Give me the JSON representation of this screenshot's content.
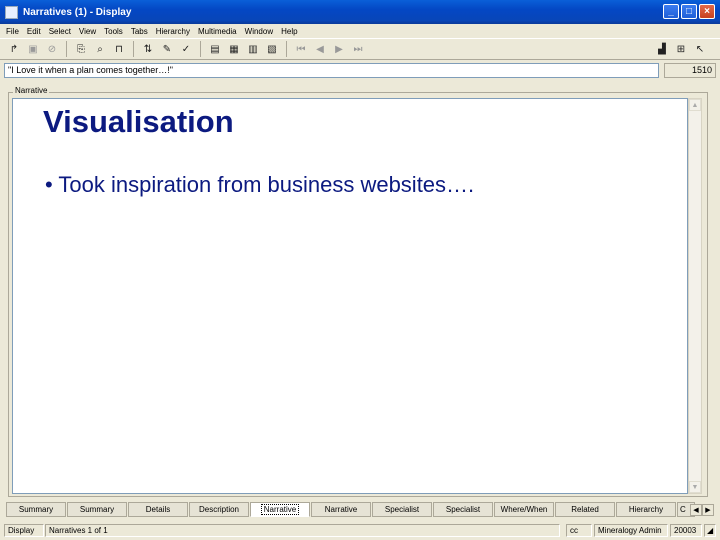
{
  "window": {
    "title": "Narratives (1) - Display",
    "controls": [
      "_",
      "□",
      "×"
    ]
  },
  "menu": [
    "File",
    "Edit",
    "Select",
    "View",
    "Tools",
    "Tabs",
    "Hierarchy",
    "Multimedia",
    "Window",
    "Help"
  ],
  "toolbar": {
    "left": [
      "new-icon",
      "save-icon",
      "cancel-icon",
      "copy-icon",
      "find-icon",
      "filter-icon",
      "sort-icon",
      "edit-icon",
      "spell-icon",
      "report-icon",
      "table-icon",
      "form-icon",
      "view-icon",
      "first-icon",
      "prev-icon",
      "next-icon",
      "last-icon"
    ],
    "right": [
      "chart-icon",
      "tag-icon",
      "help-pointer-icon"
    ]
  },
  "record": {
    "title": "\"I Love it when a plan comes together…!\"",
    "number": "1510"
  },
  "group_label": "Narrative",
  "content": {
    "heading": "Visualisation",
    "bullet": "•  Took inspiration from business websites…."
  },
  "tabs": [
    "Summary",
    "Summary",
    "Details",
    "Description",
    "Narrative",
    "Narrative",
    "Specialist",
    "Specialist",
    "Where/When",
    "Related",
    "Hierarchy",
    "C"
  ],
  "active_tab_index": 4,
  "status": {
    "mode": "Display",
    "position": "Narratives 1 of 1",
    "flag": "cc",
    "user": "Mineralogy Admin",
    "id": "20003"
  }
}
